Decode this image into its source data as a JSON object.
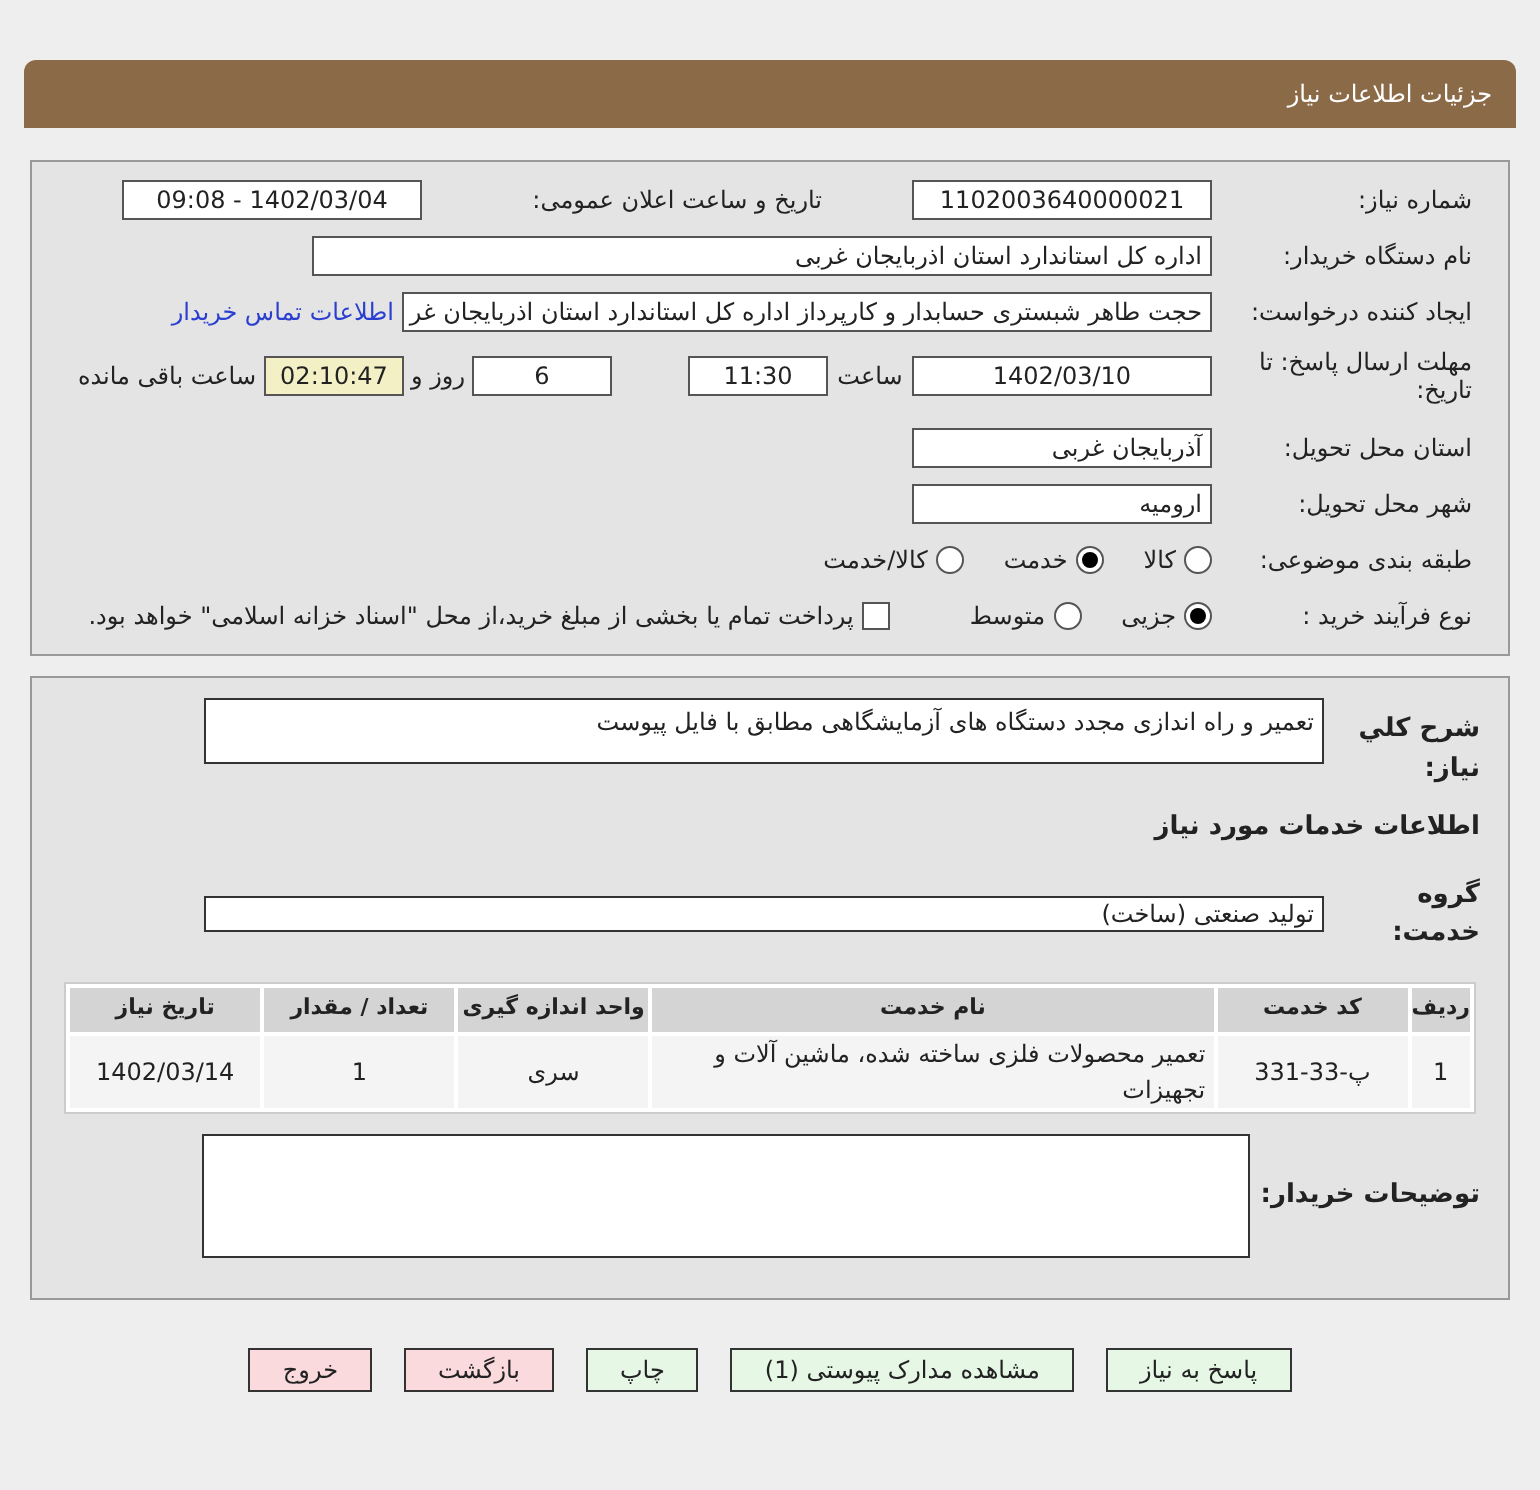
{
  "header": {
    "title": "جزئیات اطلاعات نیاز"
  },
  "need_number": {
    "label": "شماره نیاز:",
    "value": "1102003640000021"
  },
  "announce": {
    "label": "تاریخ و ساعت اعلان عمومی:",
    "value": "1402/03/04 - 09:08"
  },
  "buyer_org": {
    "label": "نام دستگاه خریدار:",
    "value": "اداره کل استاندارد استان اذربایجان غربی"
  },
  "requester": {
    "label": "ایجاد کننده درخواست:",
    "value": "حجت طاهر شبستری حسابدار و کارپرداز اداره کل استاندارد استان اذربایجان غر",
    "link": "اطلاعات تماس خریدار"
  },
  "deadline": {
    "label": "مهلت ارسال پاسخ: تا تاریخ:",
    "date": "1402/03/10",
    "time_label": "ساعت",
    "time": "11:30",
    "days": "6",
    "days_label": "روز و",
    "remaining": "02:10:47",
    "remaining_label": "ساعت باقی مانده"
  },
  "province": {
    "label": "استان محل تحویل:",
    "value": "آذربایجان غربی"
  },
  "city": {
    "label": "شهر محل تحویل:",
    "value": "ارومیه"
  },
  "category": {
    "label": "طبقه بندی موضوعی:",
    "options": [
      {
        "label": "کالا",
        "selected": false
      },
      {
        "label": "خدمت",
        "selected": true
      },
      {
        "label": "کالا/خدمت",
        "selected": false
      }
    ]
  },
  "process": {
    "label": "نوع فرآیند خرید :",
    "options": [
      {
        "label": "جزیی",
        "selected": true
      },
      {
        "label": "متوسط",
        "selected": false
      }
    ],
    "treasury": {
      "label": "پرداخت تمام یا بخشی از مبلغ خرید،از محل \"اسناد خزانه اسلامی\" خواهد بود.",
      "checked": false
    }
  },
  "description": {
    "label": "شرح کلي نياز:",
    "value": "تعمیر و راه اندازی مجدد دستگاه های آزمایشگاهی مطابق با فایل پیوست"
  },
  "services_title": "اطلاعات خدمات مورد نیاز",
  "service_group": {
    "label": "گروه خدمت:",
    "value": "تولید صنعتی (ساخت)"
  },
  "table": {
    "columns": [
      "ردیف",
      "کد خدمت",
      "نام خدمت",
      "واحد اندازه گیری",
      "تعداد / مقدار",
      "تاریخ نیاز"
    ],
    "rows": [
      [
        "1",
        "پ-33-331",
        "تعمیر محصولات فلزی ساخته شده، ماشین آلات و تجهیزات",
        "سری",
        "1",
        "1402/03/14"
      ]
    ]
  },
  "buyer_notes": {
    "label": "توضیحات خریدار:"
  },
  "buttons": [
    {
      "label": "پاسخ به نیاز",
      "kind": "primary"
    },
    {
      "label": "مشاهده مدارک پیوستی (1)",
      "kind": "primary"
    },
    {
      "label": "چاپ",
      "kind": "primary"
    },
    {
      "label": "بازگشت",
      "kind": "danger"
    },
    {
      "label": "خروج",
      "kind": "danger"
    }
  ]
}
